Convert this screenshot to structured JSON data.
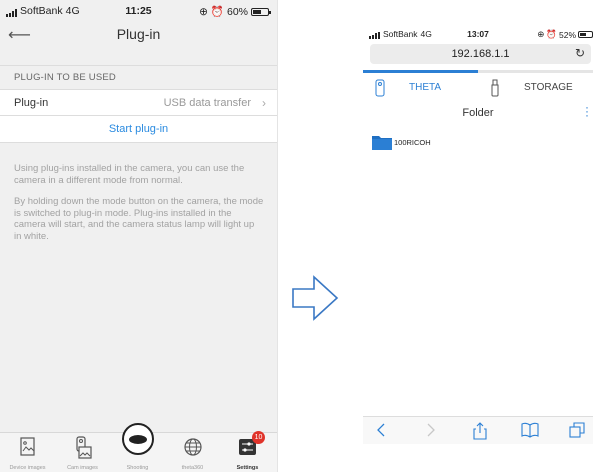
{
  "left_phone": {
    "status_bar": {
      "carrier": "SoftBank",
      "network": "4G",
      "time": "11:25",
      "battery": "60%",
      "battery_level": 0.6
    },
    "navbar": {
      "back_icon": "back-arrow-icon",
      "title": "Plug-in"
    },
    "section_header": "PLUG-IN TO BE USED",
    "plugin_row": {
      "label": "Plug-in",
      "value": "USB data transfer",
      "chevron": "›"
    },
    "start_button": "Start plug-in",
    "description": [
      "Using plug-ins installed in the camera, you can use the camera in a different mode from normal.",
      "By holding down the mode button on the camera, the mode is switched to plug-in mode. Plug-ins installed in the camera will start, and the camera status lamp will light up in white."
    ],
    "tabs": [
      {
        "label": "Device images",
        "icon": "device-images-icon",
        "active": false
      },
      {
        "label": "Cam images",
        "icon": "camera-images-icon",
        "active": false
      },
      {
        "label": "Shooting",
        "icon": "shutter-icon",
        "active": false
      },
      {
        "label": "theta360",
        "icon": "globe-icon",
        "active": false
      },
      {
        "label": "Settings",
        "icon": "settings-sliders-icon",
        "active": true,
        "badge": "10"
      }
    ]
  },
  "arrow_icon": "right-arrow-outline-icon",
  "right_phone": {
    "status_bar": {
      "carrier": "SoftBank",
      "network": "4G",
      "time": "13:07",
      "battery": "52%",
      "battery_level": 0.52
    },
    "url": "192.168.1.1",
    "reload_icon": "reload-icon",
    "tabs": [
      {
        "label": "THETA",
        "icon": "theta-camera-icon",
        "active": true
      },
      {
        "label": "STORAGE",
        "icon": "usb-storage-icon",
        "active": false
      }
    ],
    "folder_title": "Folder",
    "folders": [
      {
        "name": "100RICOH",
        "icon": "folder-icon"
      }
    ],
    "toolbar": [
      "back-icon",
      "forward-icon",
      "share-icon",
      "bookmarks-icon",
      "tabs-icon"
    ],
    "colors": {
      "accent": "#2b7fd4"
    }
  },
  "colors": {
    "link_blue": "#2b8be0",
    "badge_red": "#e0332a"
  }
}
